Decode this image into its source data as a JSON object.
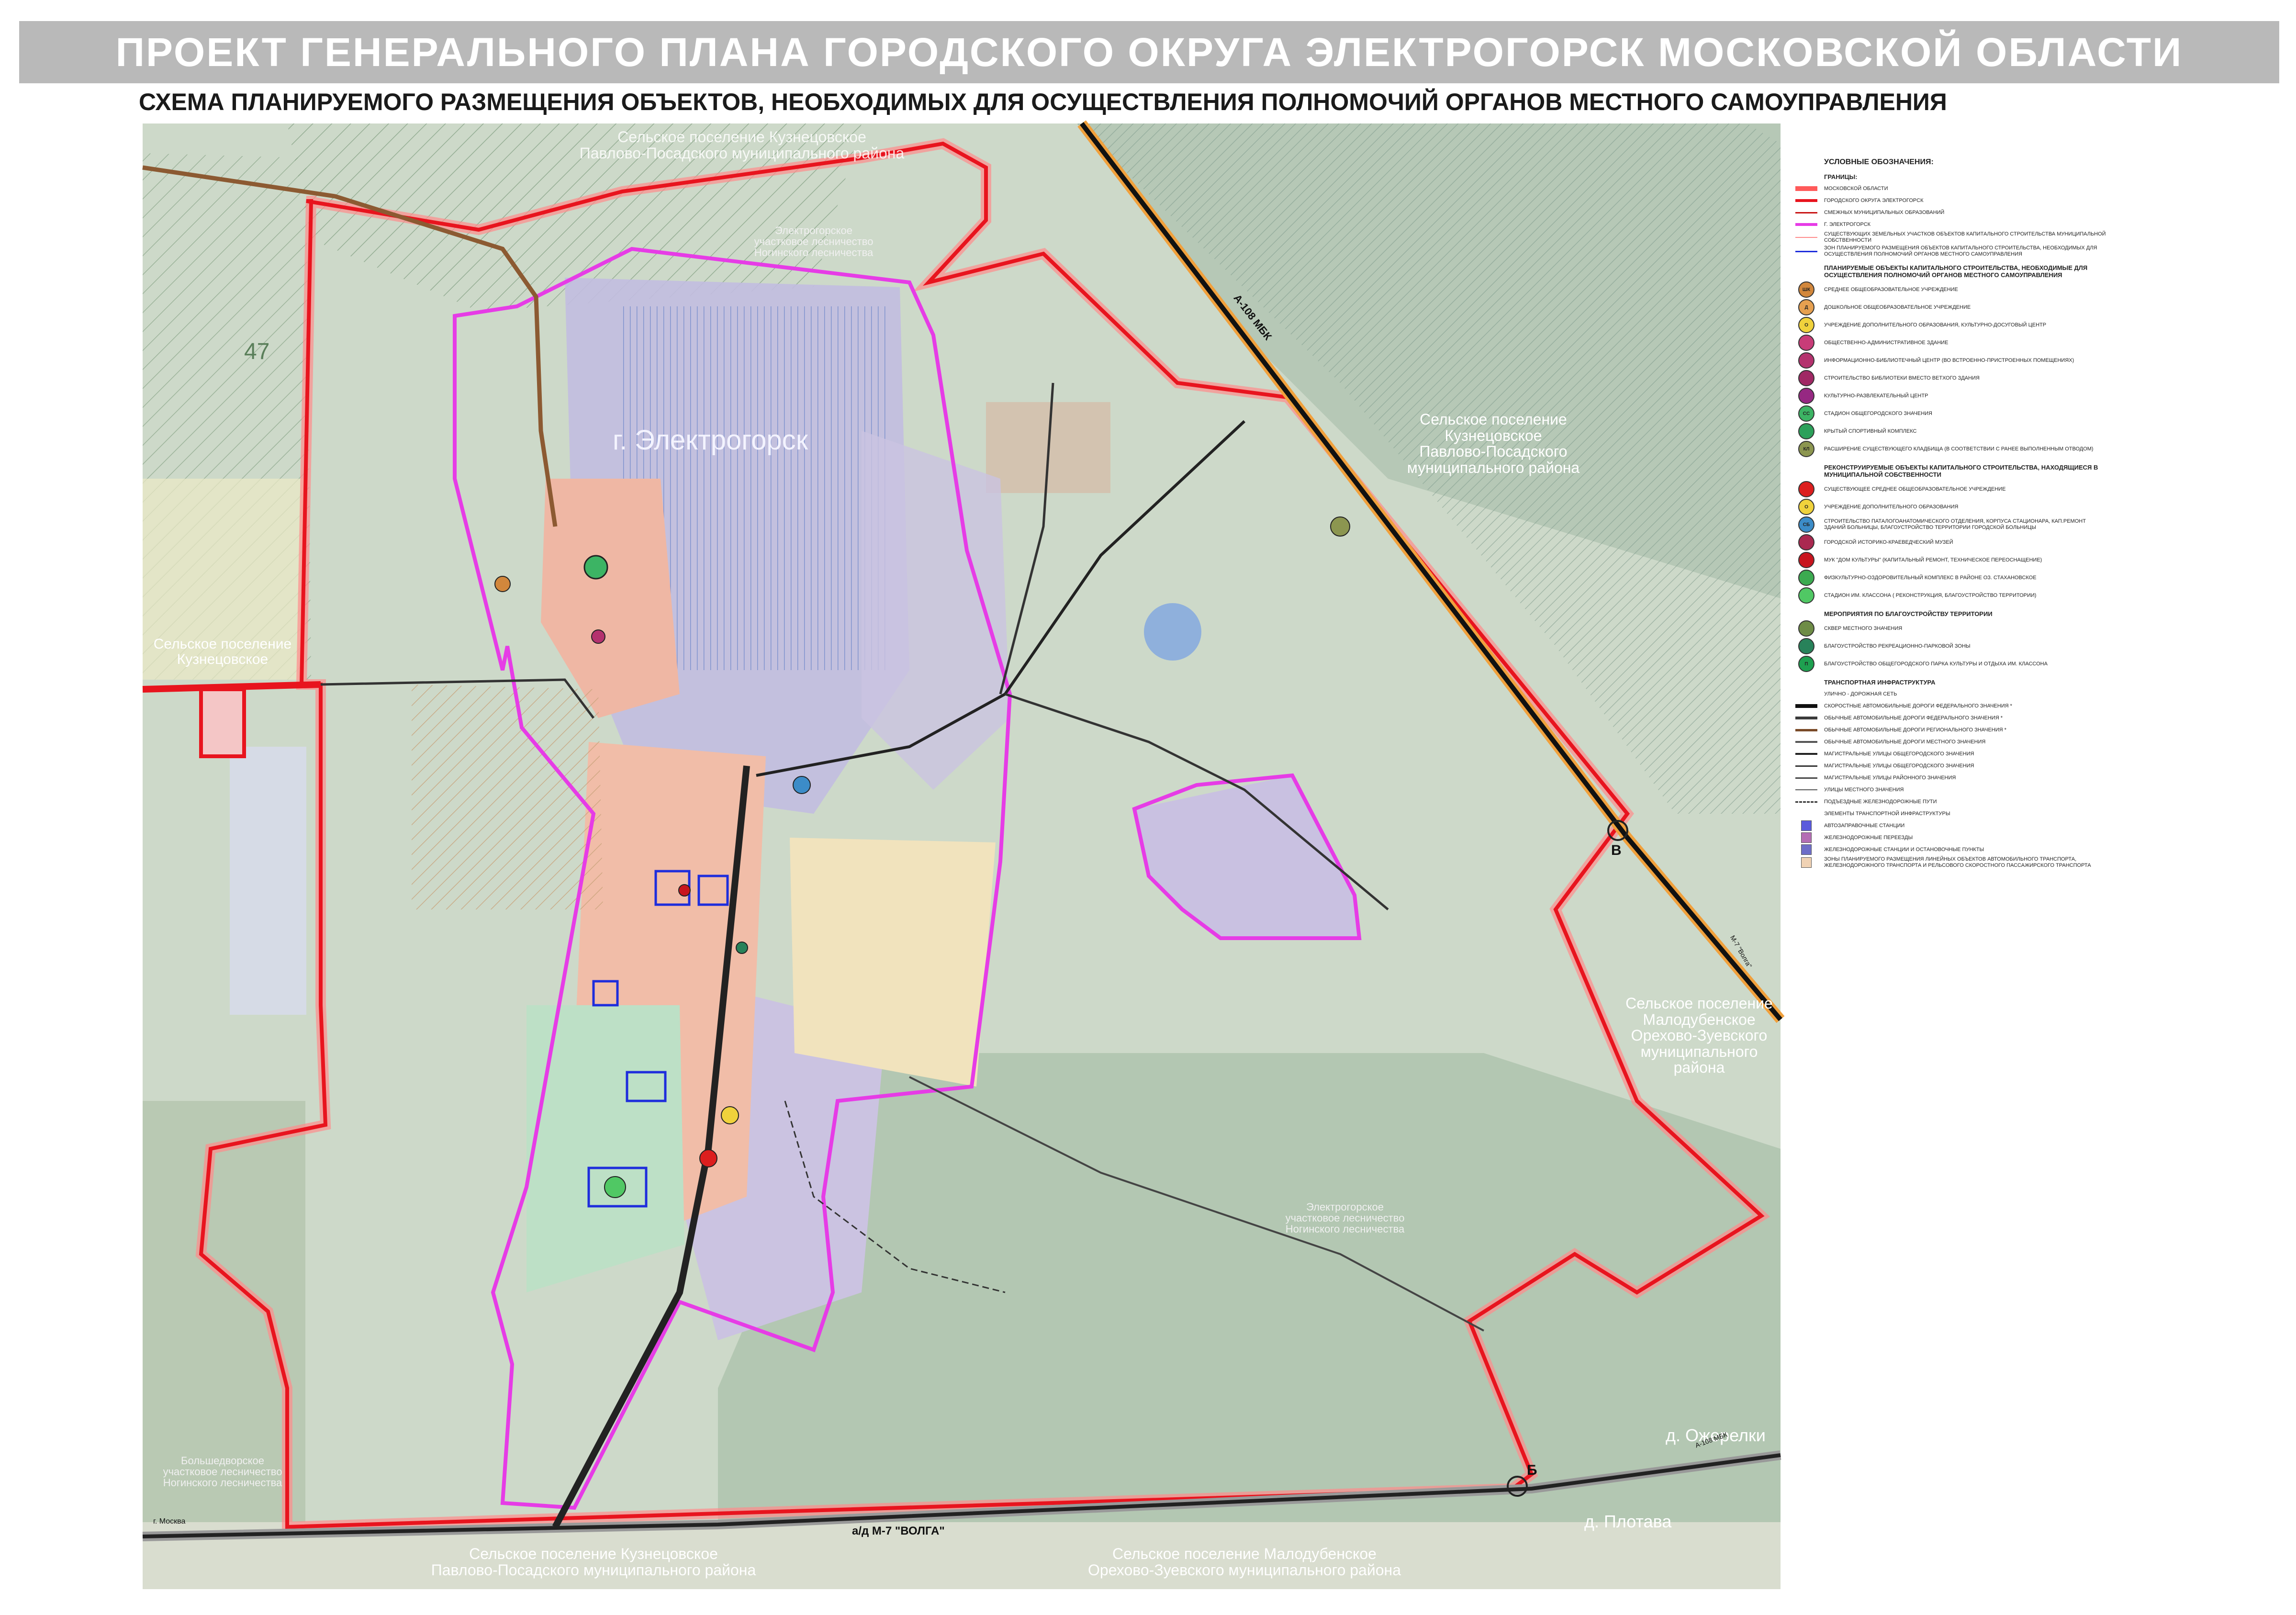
{
  "header": {
    "title": "ПРОЕКТ ГЕНЕРАЛЬНОГО ПЛАНА ГОРОДСКОГО ОКРУГА ЭЛЕКТРОГОРСК МОСКОВСКОЙ ОБЛАСТИ",
    "subtitle": "СХЕМА ПЛАНИРУЕМОГО РАЗМЕЩЕНИЯ ОБЪЕКТОВ, НЕОБХОДИМЫХ ДЛЯ ОСУЩЕСТВЛЕНИЯ ПОЛНОМОЧИЙ ОРГАНОВ МЕСТНОГО САМОУПРАВЛЕНИЯ"
  },
  "map": {
    "labels": {
      "city": "г. Электрогорск",
      "kuznetsovskoe": "Сельское поселение\nКузнецовское",
      "kuznetsovskoe_top": "Сельское поселение Кузнецовское\nПавлово-Посадского муниципального района",
      "electrogorsk_forest_top": "Электрогорское\nучастковое лесничество\nНогинского лесничества",
      "electrogorsk_forest_bottom": "Электрогорское\nучастковое лесничество\nНогинского лесничества",
      "bolshedvorskoe": "Большедворское\nучастковое лесничество\nНогинского лесничества",
      "kuznetsovskoe_right": "Сельское поселение\nКузнецовское\nПавлово-Посадского\nмуниципального района",
      "malodubenskoe_right": "Сельское поселение\nМалодубенское\nОрехово-Зуевского\nмуниципального\nрайона",
      "kuznetsovskoe_bottom": "Сельское поселение Кузнецовское\nПавлово-Посадского муниципального района",
      "malodubenskoe_bottom": "Сельское поселение Малодубенское\nОрехово-Зуевского муниципального района",
      "ozherelki": "д. Ожерелки",
      "plotava": "д. Плотава",
      "quarter_47": "47"
    },
    "roads": {
      "a108": "А-108 МБК",
      "volga": "а/д М-7 \"ВОЛГА\"",
      "moscow": "г. Москва",
      "a108_small": "А-108 МБК",
      "m7_small": "М-7 \"Волга\""
    },
    "points": {
      "b": "Б",
      "v": "В"
    }
  },
  "legend": {
    "title": "УСЛОВНЫЕ ОБОЗНАЧЕНИЯ:",
    "sections": [
      {
        "heading": "ГРАНИЦЫ:",
        "items": [
          {
            "symbol": "line",
            "color": "#ff5a5a",
            "width": 10,
            "label": "МОСКОВСКОЙ ОБЛАСТИ"
          },
          {
            "symbol": "line",
            "color": "#e8141e",
            "width": 6,
            "label": "ГОРОДСКОГО ОКРУГА ЭЛЕКТРОГОРСК"
          },
          {
            "symbol": "line",
            "color": "#c81414",
            "width": 3,
            "label": "СМЕЖНЫХ МУНИЦИПАЛЬНЫХ ОБРАЗОВАНИЙ"
          },
          {
            "symbol": "line",
            "color": "#e63ce6",
            "width": 6,
            "label": "Г. ЭЛЕКТРОГОРСК"
          },
          {
            "symbol": "line",
            "color": "#ff8c8c",
            "width": 2,
            "label": "СУЩЕСТВУЮЩИХ ЗЕМЕЛЬНЫХ УЧАСТКОВ ОБЪЕКТОВ КАПИТАЛЬНОГО СТРОИТЕЛЬСТВА МУНИЦИПАЛЬНОЙ СОБСТВЕННОСТИ"
          },
          {
            "symbol": "line",
            "color": "#1e2ddc",
            "width": 3,
            "label": "ЗОН ПЛАНИРУЕМОГО РАЗМЕЩЕНИЯ ОБЪЕКТОВ КАПИТАЛЬНОГО СТРОИТЕЛЬСТВА, НЕОБХОДИМЫХ ДЛЯ ОСУЩЕСТВЛЕНИЯ ПОЛНОМОЧИЙ ОРГАНОВ МЕСТНОГО САМОУПРАВЛЕНИЯ"
          }
        ]
      },
      {
        "heading": "ПЛАНИРУЕМЫЕ ОБЪЕКТЫ КАПИТАЛЬНОГО СТРОИТЕЛЬСТВА, НЕОБХОДИМЫЕ ДЛЯ ОСУЩЕСТВЛЕНИЯ ПОЛНОМОЧИЙ ОРГАНОВ МЕСТНОГО САМОУПРАВЛЕНИЯ",
        "items": [
          {
            "symbol": "circle",
            "color": "#d2873c",
            "code": "ШК",
            "label": "СРЕДНЕЕ ОБЩЕОБРАЗОВАТЕЛЬНОЕ УЧРЕЖДЕНИЕ"
          },
          {
            "symbol": "circle",
            "color": "#e6a050",
            "code": "Д",
            "label": "ДОШКОЛЬНОЕ ОБЩЕОБРАЗОВАТЕЛЬНОЕ УЧРЕЖДЕНИЕ"
          },
          {
            "symbol": "circle",
            "color": "#f0d23c",
            "code": "О",
            "label": "УЧРЕЖДЕНИЕ ДОПОЛНИТЕЛЬНОГО ОБРАЗОВАНИЯ, КУЛЬТУРНО-ДОСУГОВЫЙ ЦЕНТР"
          },
          {
            "symbol": "circle",
            "color": "#c83c78",
            "code": "",
            "label": "ОБЩЕСТВЕННО-АДМИНИСТРАТИВНОЕ ЗДАНИЕ"
          },
          {
            "symbol": "circle",
            "color": "#b4326e",
            "code": "",
            "label": "ИНФОРМАЦИОННО-БИБЛИОТЕЧНЫЙ ЦЕНТР (ВО ВСТРОЕННО-ПРИСТРОЕННЫХ ПОМЕЩЕНИЯХ)"
          },
          {
            "symbol": "circle",
            "color": "#a02864",
            "code": "",
            "label": "СТРОИТЕЛЬСТВО БИБЛИОТЕКИ ВМЕСТО ВЕТХОГО ЗДАНИЯ"
          },
          {
            "symbol": "circle",
            "color": "#962882",
            "code": "",
            "label": "КУЛЬТУРНО-РАЗВЛЕКАТЕЛЬНЫЙ ЦЕНТР"
          },
          {
            "symbol": "circle",
            "color": "#3cb464",
            "code": "СС",
            "label": "СТАДИОН ОБЩЕГОРОДСКОГО ЗНАЧЕНИЯ"
          },
          {
            "symbol": "circle",
            "color": "#2ca05a",
            "code": "",
            "label": "КРЫТЫЙ СПОРТИВНЫЙ КОМПЛЕКС"
          },
          {
            "symbol": "circle",
            "color": "#8c9650",
            "code": "КЛ",
            "label": "РАСШИРЕНИЕ СУЩЕСТВУЮЩЕГО КЛАДБИЩА (В СООТВЕТСТВИИ С РАНЕЕ ВЫПОЛНЕННЫМ ОТВОДОМ)"
          }
        ]
      },
      {
        "heading": "РЕКОНСТРУИРУЕМЫЕ ОБЪЕКТЫ КАПИТАЛЬНОГО СТРОИТЕЛЬСТВА, НАХОДЯЩИЕСЯ В МУНИЦИПАЛЬНОЙ СОБСТВЕННОСТИ",
        "items": [
          {
            "symbol": "circle",
            "color": "#dc1e1e",
            "code": "",
            "label": "СУЩЕСТВУЮЩЕЕ СРЕДНЕЕ ОБЩЕОБРАЗОВАТЕЛЬНОЕ УЧРЕЖДЕНИЕ"
          },
          {
            "symbol": "circle",
            "color": "#f0d23c",
            "code": "О",
            "label": "УЧРЕЖДЕНИЕ ДОПОЛНИТЕЛЬНОГО ОБРАЗОВАНИЯ"
          },
          {
            "symbol": "circle",
            "color": "#3c8cc8",
            "code": "СБ",
            "label": "СТРОИТЕЛЬСТВО ПАТАЛОГОАНАТОМИЧЕСКОГО ОТДЕЛЕНИЯ, КОРПУСА СТАЦИОНАРА, КАП.РЕМОНТ ЗДАНИЙ БОЛЬНИЦЫ, БЛАГОУСТРОЙСТВО ТЕРРИТОРИИ ГОРОДСКОЙ БОЛЬНИЦЫ"
          },
          {
            "symbol": "circle",
            "color": "#aa2850",
            "code": "",
            "label": "ГОРОДСКОЙ ИСТОРИКО-КРАЕВЕДЧЕСКИЙ МУЗЕЙ"
          },
          {
            "symbol": "circle",
            "color": "#c8141e",
            "code": "",
            "label": "МУК \"ДОМ КУЛЬТУРЫ\" (КАПИТАЛЬНЫЙ РЕМОНТ, ТЕХНИЧЕСКОЕ ПЕРЕОСНАЩЕНИЕ)"
          },
          {
            "symbol": "circle",
            "color": "#3caa50",
            "code": "",
            "label": "ФИЗКУЛЬТУРНО-ОЗДОРОВИТЕЛЬНЫЙ КОМПЛЕКС В РАЙОНЕ ОЗ. СТАХАНОВСКОЕ"
          },
          {
            "symbol": "circle",
            "color": "#50c864",
            "code": "",
            "label": "СТАДИОН ИМ. КЛАССОНА ( РЕКОНСТРУКЦИЯ, БЛАГОУСТРОЙСТВО ТЕРРИТОРИИ)"
          }
        ]
      },
      {
        "heading": "МЕРОПРИЯТИЯ ПО БЛАГОУСТРОЙСТВУ ТЕРРИТОРИИ",
        "items": [
          {
            "symbol": "circle",
            "color": "#6e8c46",
            "code": "",
            "label": "СКВЕР МЕСТНОГО ЗНАЧЕНИЯ"
          },
          {
            "symbol": "circle",
            "color": "#28825a",
            "code": "",
            "label": "БЛАГОУСТРОЙСТВО РЕКРЕАЦИОННО-ПАРКОВОЙ ЗОНЫ"
          },
          {
            "symbol": "circle",
            "color": "#1ea050",
            "code": "П",
            "label": "БЛАГОУСТРОЙСТВО ОБЩЕГОРОДСКОГО ПАРКА КУЛЬТУРЫ И ОТДЫХА ИМ. КЛАССОНА"
          }
        ]
      },
      {
        "heading": "ТРАНСПОРТНАЯ ИНФРАСТРУКТУРА",
        "items": [
          {
            "symbol": "text",
            "color": "#222",
            "label": "УЛИЧНО - ДОРОЖНАЯ СЕТЬ"
          },
          {
            "symbol": "line",
            "color": "#111111",
            "width": 8,
            "label": "СКОРОСТНЫЕ АВТОМОБИЛЬНЫЕ ДОРОГИ ФЕДЕРАЛЬНОГО ЗНАЧЕНИЯ *"
          },
          {
            "symbol": "line",
            "color": "#3a3a3a",
            "width": 6,
            "label": "ОБЫЧНЫЕ АВТОМОБИЛЬНЫЕ ДОРОГИ ФЕДЕРАЛЬНОГО ЗНАЧЕНИЯ *"
          },
          {
            "symbol": "line",
            "color": "#7a4a28",
            "width": 5,
            "label": "ОБЫЧНЫЕ АВТОМОБИЛЬНЫЕ ДОРОГИ РЕГИОНАЛЬНОГО ЗНАЧЕНИЯ *"
          },
          {
            "symbol": "line",
            "color": "#555555",
            "width": 4,
            "label": "ОБЫЧНЫЕ АВТОМОБИЛЬНЫЕ ДОРОГИ МЕСТНОГО ЗНАЧЕНИЯ"
          },
          {
            "symbol": "line",
            "color": "#222222",
            "width": 4,
            "label": "МАГИСТРАЛЬНЫЕ УЛИЦЫ ОБЩЕГОРОДСКОГО ЗНАЧЕНИЯ"
          },
          {
            "symbol": "line",
            "color": "#333333",
            "width": 3,
            "label": "МАГИСТРАЛЬНЫЕ УЛИЦЫ ОБЩЕГОРОДСКОГО ЗНАЧЕНИЯ"
          },
          {
            "symbol": "line",
            "color": "#444444",
            "width": 3,
            "label": "МАГИСТРАЛЬНЫЕ УЛИЦЫ РАЙОННОГО ЗНАЧЕНИЯ"
          },
          {
            "symbol": "line",
            "color": "#555555",
            "width": 2,
            "label": "УЛИЦЫ МЕСТНОГО ЗНАЧЕНИЯ"
          },
          {
            "symbol": "rail",
            "color": "#333333",
            "width": 2,
            "label": "ПОДЪЕЗДНЫЕ ЖЕЛЕЗНОДОРОЖНЫЕ ПУТИ"
          },
          {
            "symbol": "text",
            "color": "#222",
            "label": "ЭЛЕМЕНТЫ ТРАНСПОРТНОЙ ИНФРАСТРУКТУРЫ"
          },
          {
            "symbol": "square",
            "color": "#5a5adc",
            "label": "АВТОЗАПРАВОЧНЫЕ СТАНЦИИ"
          },
          {
            "symbol": "square",
            "color": "#b46eb4",
            "label": "ЖЕЛЕЗНОДОРОЖНЫЕ ПЕРЕЕЗДЫ"
          },
          {
            "symbol": "square",
            "color": "#6e6ec8",
            "label": "ЖЕЛЕЗНОДОРОЖНЫЕ СТАНЦИИ И ОСТАНОВОЧНЫЕ ПУНКТЫ"
          },
          {
            "symbol": "square",
            "color": "#f0d2b4",
            "label": "ЗОНЫ ПЛАНИРУЕМОГО РАЗМЕЩЕНИЯ ЛИНЕЙНЫХ ОБЪЕКТОВ АВТОМОБИЛЬНОГО ТРАНСПОРТА, ЖЕЛЕЗНОДОРОЖНОГО ТРАНСПОРТА И РЕЛЬСОВОГО СКОРОСТНОГО ПАССАЖИРСКОГО ТРАНСПОРТА"
          }
        ]
      }
    ]
  },
  "colors": {
    "district_boundary": "#e8141e",
    "city_boundary": "#e63ce6",
    "forest": "#b8cbb3",
    "residential": "#f2b9a6",
    "industrial": "#c9c0e0",
    "water": "#8fb0dc"
  }
}
